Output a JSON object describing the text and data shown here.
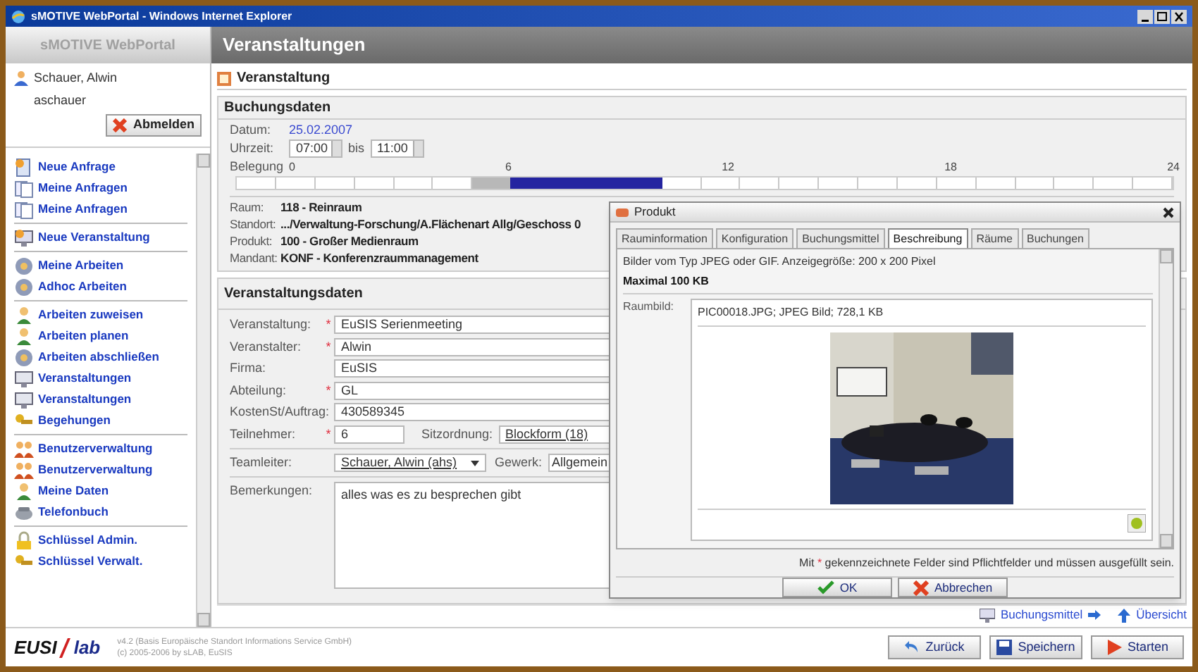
{
  "window": {
    "title": "sMOTIVE WebPortal - Windows Internet Explorer"
  },
  "app_title": "sMOTIVE WebPortal",
  "page_title": "Veranstaltungen",
  "user": {
    "name": "Schauer, Alwin",
    "login": "aschauer",
    "logout": "Abmelden"
  },
  "sidebar": {
    "groups": [
      [
        {
          "label": "Neue Anfrage",
          "kind": "doc-new"
        },
        {
          "label": "Meine Anfragen",
          "kind": "doc"
        },
        {
          "label": "Meine Anfragen",
          "kind": "doc"
        }
      ],
      [
        {
          "label": "Neue Veranstaltung",
          "kind": "event"
        }
      ],
      [
        {
          "label": "Meine Arbeiten",
          "kind": "gear"
        },
        {
          "label": "Adhoc Arbeiten",
          "kind": "gear"
        }
      ],
      [
        {
          "label": "Arbeiten zuweisen",
          "kind": "person"
        },
        {
          "label": "Arbeiten planen",
          "kind": "person"
        },
        {
          "label": "Arbeiten abschließen",
          "kind": "gear"
        },
        {
          "label": "Veranstaltungen",
          "kind": "monitor"
        },
        {
          "label": "Veranstaltungen",
          "kind": "monitor"
        },
        {
          "label": "Begehungen",
          "kind": "keys"
        }
      ],
      [
        {
          "label": "Benutzerverwaltung",
          "kind": "users"
        },
        {
          "label": "Benutzerverwaltung",
          "kind": "users"
        },
        {
          "label": "Meine Daten",
          "kind": "person"
        },
        {
          "label": "Telefonbuch",
          "kind": "phone"
        }
      ],
      [
        {
          "label": "Schlüssel Admin.",
          "kind": "lock"
        },
        {
          "label": "Schlüssel Verwalt.",
          "kind": "keys"
        }
      ]
    ]
  },
  "panel_title": "Veranstaltung",
  "booking": {
    "heading": "Buchungsdaten",
    "date_label": "Datum:",
    "date": "25.02.2007",
    "time_label": "Uhrzeit:",
    "time_from": "07:00",
    "time_sep": "bis",
    "time_to": "11:00",
    "occupancy_label": "Belegung",
    "ticks": [
      "0",
      "6",
      "12",
      "18",
      "24"
    ],
    "slots": [
      {
        "kind": "free"
      },
      {
        "kind": "free"
      },
      {
        "kind": "free"
      },
      {
        "kind": "free"
      },
      {
        "kind": "free"
      },
      {
        "kind": "free"
      },
      {
        "kind": "buffer"
      },
      {
        "kind": "booked"
      },
      {
        "kind": "booked"
      },
      {
        "kind": "booked"
      },
      {
        "kind": "booked"
      },
      {
        "kind": "free"
      },
      {
        "kind": "free"
      },
      {
        "kind": "free"
      },
      {
        "kind": "free"
      },
      {
        "kind": "free"
      },
      {
        "kind": "free"
      },
      {
        "kind": "free"
      },
      {
        "kind": "free"
      },
      {
        "kind": "free"
      },
      {
        "kind": "free"
      },
      {
        "kind": "free"
      },
      {
        "kind": "free"
      },
      {
        "kind": "free"
      }
    ],
    "details": [
      {
        "label": "Raum:",
        "value": "118 - Reinraum"
      },
      {
        "label": "Standort:",
        "value": ".../Verwaltung-Forschung/A.Flächenart Allg/Geschoss 0"
      },
      {
        "label": "Produkt:",
        "value": "100 - Großer Medienraum"
      },
      {
        "label": "Mandant:",
        "value": "KONF - Konferenzraummanagement"
      }
    ]
  },
  "event": {
    "heading": "Veranstaltungsdaten",
    "required_mark": "*",
    "fields": [
      {
        "label": "Veranstaltung:",
        "required": true,
        "value": "EuSIS Serienmeeting"
      },
      {
        "label": "Veranstalter:",
        "required": true,
        "value": "Alwin"
      },
      {
        "label": "Firma:",
        "required": false,
        "value": "EuSIS"
      },
      {
        "label": "Abteilung:",
        "required": true,
        "value": "GL"
      },
      {
        "label": "KostenSt/Auftrag:",
        "required": false,
        "value": "430589345"
      }
    ],
    "participants": {
      "label": "Teilnehmer:",
      "required": true,
      "value": "6"
    },
    "seating": {
      "label": "Sitzordnung:",
      "value": "Blockform (18)"
    },
    "team_lead": {
      "label": "Teamleiter:",
      "value": "Schauer, Alwin (ahs)"
    },
    "trade": {
      "label": "Gewerk:",
      "value": "Allgemein"
    },
    "remarks": {
      "label": "Bemerkungen:",
      "value": "alles was es zu besprechen gibt"
    }
  },
  "popup": {
    "title": "Produkt",
    "tabs": [
      {
        "label": "Rauminformation",
        "selected": false
      },
      {
        "label": "Konfiguration",
        "selected": false
      },
      {
        "label": "Buchungsmittel",
        "selected": false
      },
      {
        "label": "Beschreibung",
        "selected": true
      },
      {
        "label": "Räume",
        "selected": false
      },
      {
        "label": "Buchungen",
        "selected": false
      }
    ],
    "info": "Bilder vom Typ JPEG oder GIF. Anzeigegröße: 200 x 200 Pixel",
    "max": "Maximal 100 KB",
    "image_label": "Raumbild:",
    "file": "PIC00018.JPG; JPEG Bild; 728,1 KB",
    "note": {
      "before": "Mit",
      "mark": "*",
      "after": "gekennzeichnete Felder sind Pflichtfelder und müssen ausgefüllt sein."
    },
    "buttons": [
      {
        "label": "OK",
        "kind": "ok"
      },
      {
        "label": "Abbrechen",
        "kind": "cancel"
      }
    ]
  },
  "links": [
    {
      "label": "Buchungsmittel",
      "kind": "resource"
    },
    {
      "label": "Übersicht",
      "kind": "overview"
    }
  ],
  "footer": {
    "logo_left": "EUSI",
    "logo_right": "lab",
    "version": "v4.2 (Basis Europäische Standort Informations Service GmbH)",
    "copyright": "(c) 2005-2006 by sLAB, EuSIS",
    "buttons": [
      {
        "label": "Zurück",
        "kind": "back"
      },
      {
        "label": "Speichern",
        "kind": "save"
      },
      {
        "label": "Starten",
        "kind": "start"
      }
    ]
  }
}
